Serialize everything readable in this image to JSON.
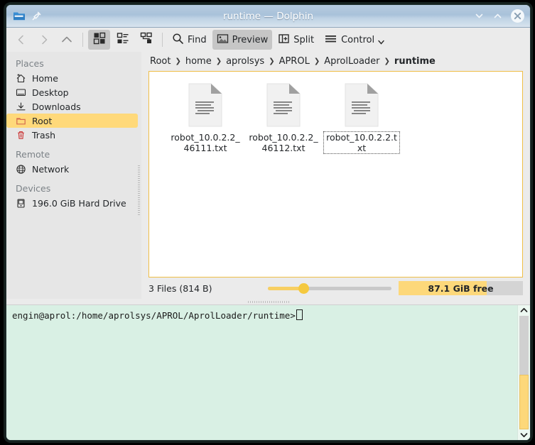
{
  "window": {
    "title": "runtime — Dolphin",
    "app_icon": "folder-icon",
    "pin_icon": "pin-icon",
    "minimize_icon": "chevron-down-icon",
    "maximize_icon": "chevron-up-icon",
    "close_icon": "close-icon"
  },
  "toolbar": {
    "back_icon": "chevron-left-icon",
    "forward_icon": "chevron-right-icon",
    "up_icon": "chevron-up-icon",
    "view_icons_icon": "view-icons-icon",
    "view_compact_icon": "view-compact-icon",
    "view_details_icon": "view-details-icon",
    "find_label": "Find",
    "find_icon": "search-icon",
    "preview_label": "Preview",
    "preview_icon": "image-icon",
    "split_label": "Split",
    "split_icon": "split-icon",
    "control_label": "Control",
    "control_icon": "hamburger-icon",
    "control_arrow_icon": "chevron-down-icon"
  },
  "sidebar": {
    "sections": [
      {
        "header": "Places",
        "items": [
          {
            "label": "Home",
            "icon": "home-icon",
            "selected": false
          },
          {
            "label": "Desktop",
            "icon": "desktop-icon",
            "selected": false
          },
          {
            "label": "Downloads",
            "icon": "download-icon",
            "selected": false
          },
          {
            "label": "Root",
            "icon": "folder-icon",
            "selected": true
          },
          {
            "label": "Trash",
            "icon": "trash-icon",
            "selected": false
          }
        ]
      },
      {
        "header": "Remote",
        "items": [
          {
            "label": "Network",
            "icon": "network-icon",
            "selected": false
          }
        ]
      },
      {
        "header": "Devices",
        "items": [
          {
            "label": "196.0 GiB Hard Drive",
            "icon": "harddrive-icon",
            "selected": false
          }
        ]
      }
    ]
  },
  "breadcrumb": {
    "separator": "❯",
    "crumbs": [
      "Root",
      "home",
      "aprolsys",
      "APROL",
      "AprolLoader",
      "runtime"
    ]
  },
  "files": [
    {
      "name": "robot_10.0.2.2_46111.txt",
      "icon": "text-file-icon",
      "focused": false
    },
    {
      "name": "robot_10.0.2.2_46112.txt",
      "icon": "text-file-icon",
      "focused": false
    },
    {
      "name": "robot_10.0.2.2.txt",
      "icon": "text-file-icon",
      "focused": true
    }
  ],
  "statusbar": {
    "summary": "3 Files (814 B)",
    "zoom_slider": {
      "percent": 27
    },
    "free_space": {
      "label": "87.1 GiB free",
      "used_percent": 71
    }
  },
  "terminal": {
    "prompt": "engin@aprol:/home/aprolsys/APROL/AprolLoader/runtime>",
    "scroll_up_icon": "caret-up-icon",
    "scroll_down_icon": "caret-down-icon"
  },
  "colors": {
    "accent": "#f5c93f",
    "selection": "#ffd97a",
    "view_border": "#efbe46",
    "terminal_bg": "#d9f0e4",
    "titlebar": "#a9c2da"
  }
}
